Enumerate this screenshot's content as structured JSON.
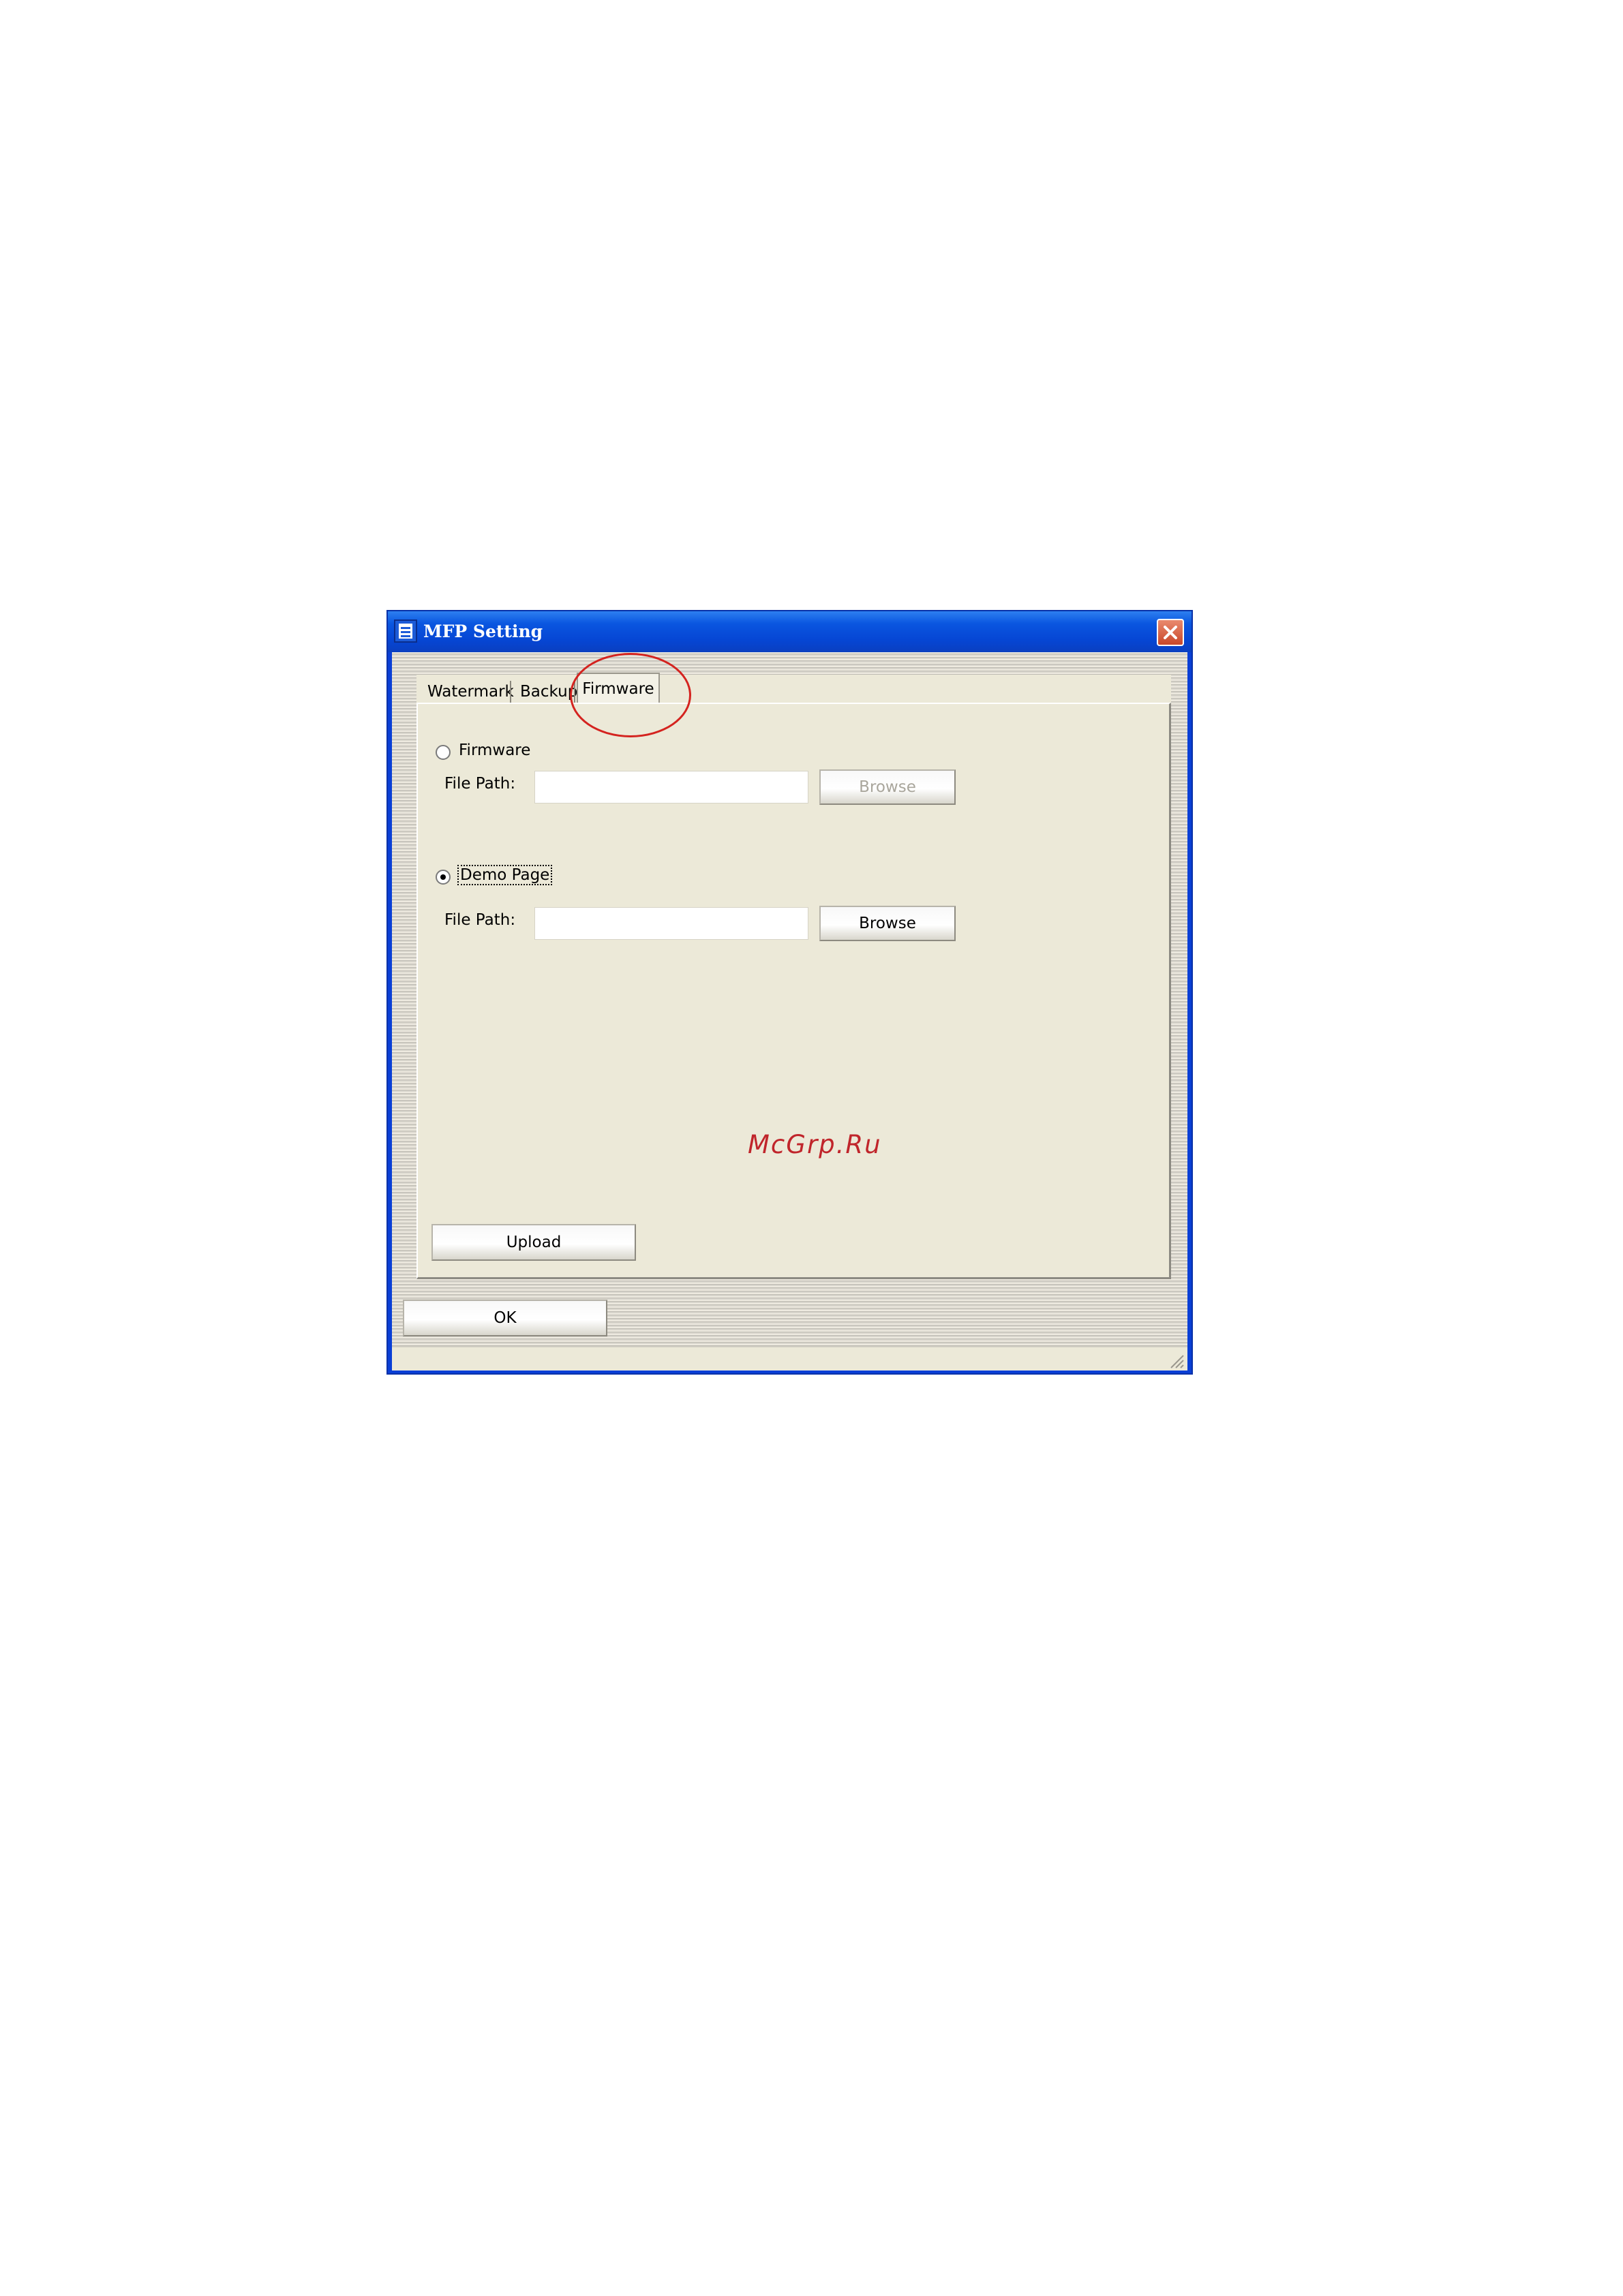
{
  "window": {
    "title": "MFP Setting"
  },
  "tabs": [
    {
      "label": "Watermark",
      "active": false
    },
    {
      "label": "Backup",
      "active": false
    },
    {
      "label": "Firmware",
      "active": true
    }
  ],
  "firmware_section": {
    "radio_label": "Firmware",
    "selected": false,
    "file_path_label": "File Path:",
    "file_path_value": "",
    "browse_label": "Browse",
    "browse_enabled": false
  },
  "demo_section": {
    "radio_label": "Demo Page",
    "selected": true,
    "file_path_label": "File Path:",
    "file_path_value": "",
    "browse_label": "Browse",
    "browse_enabled": true
  },
  "upload_label": "Upload",
  "ok_label": "OK",
  "watermark_text": "McGrp.Ru",
  "colors": {
    "titlebar": "#0a56e0",
    "highlight_circle": "#d4231f",
    "watermark": "#c0252b"
  },
  "icons": {
    "app": "app-window-icon",
    "close": "close-icon",
    "grip": "resize-grip-icon"
  }
}
